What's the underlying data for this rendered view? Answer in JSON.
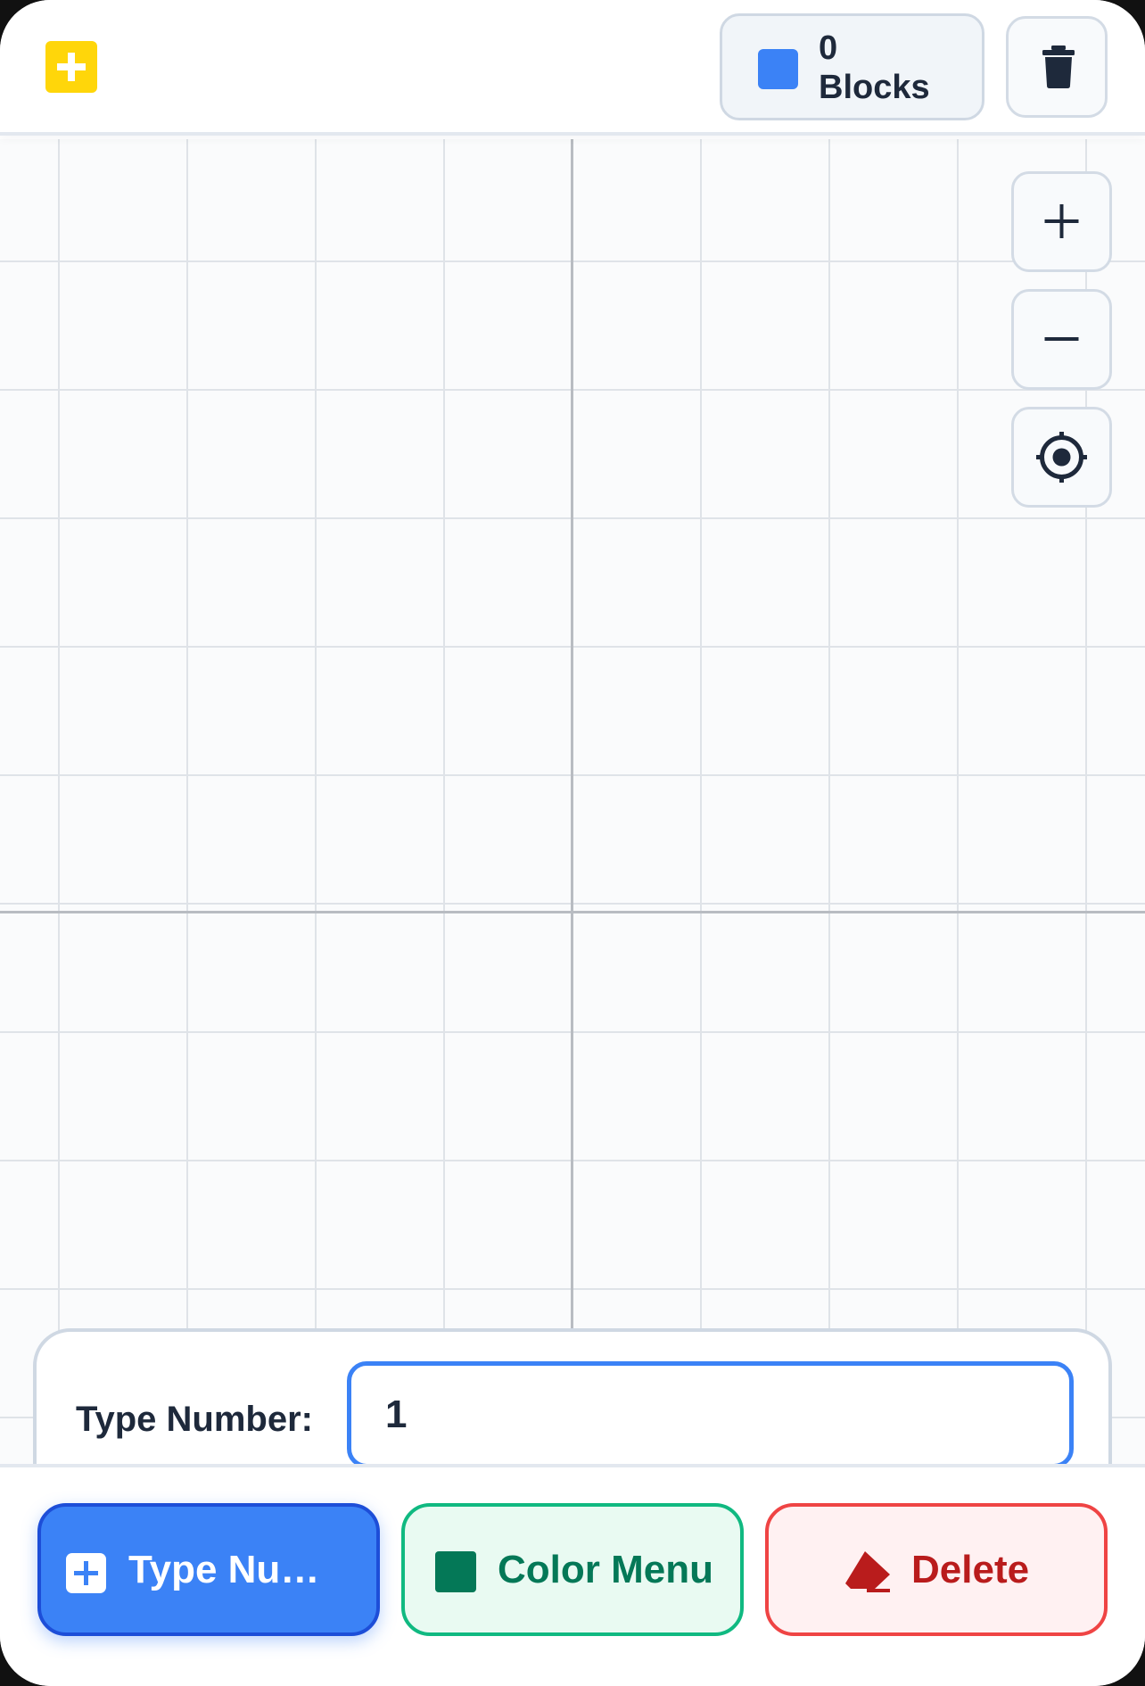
{
  "header": {
    "logo_icon": "plus-square-icon",
    "logo_color": "#ffd60a",
    "block_counter": {
      "count": "0",
      "label": "Blocks",
      "swatch_color": "#3b82f6"
    },
    "trash_icon": "trash-icon"
  },
  "canvas": {
    "grid": true,
    "axes": true,
    "controls": [
      {
        "name": "zoom-in",
        "icon": "plus-icon"
      },
      {
        "name": "zoom-out",
        "icon": "minus-icon"
      },
      {
        "name": "recenter",
        "icon": "crosshair-icon"
      }
    ]
  },
  "number_panel": {
    "label": "Type Number:",
    "value": "1"
  },
  "toolbar": {
    "type_number": {
      "label": "Type Number",
      "icon": "plus-square-icon",
      "color": "#3b82f6"
    },
    "color_menu": {
      "label": "Color Menu",
      "icon": "color-swatch-icon",
      "color": "#047857"
    },
    "delete": {
      "label": "Delete",
      "icon": "eraser-icon",
      "color": "#b91c1c"
    }
  }
}
